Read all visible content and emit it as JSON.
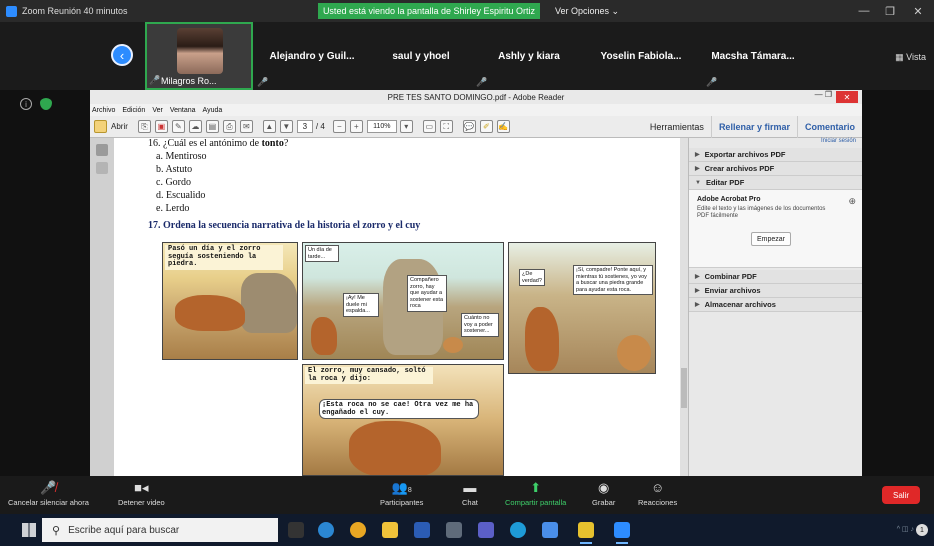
{
  "zoom": {
    "window_title": "Zoom Reunión 40 minutos",
    "share_banner": "Usted está viendo la pantalla de Shirley Espiritu Ortiz",
    "view_options": "Ver Opciones ⌄",
    "vista_label": "Vista",
    "participants": [
      {
        "name": "Milagros Ro..."
      },
      {
        "name": "Alejandro y Guil..."
      },
      {
        "name": "saul y yhoel"
      },
      {
        "name": "Ashly y kiara"
      },
      {
        "name": "Yoselin Fabiola..."
      },
      {
        "name": "Macsha Támara..."
      }
    ]
  },
  "adobe": {
    "title": "PRE TES SANTO DOMINGO.pdf - Adobe Reader",
    "menu": [
      "Archivo",
      "Edición",
      "Ver",
      "Ventana",
      "Ayuda"
    ],
    "toolbar": {
      "open_label": "Abrir",
      "page_current": "3",
      "page_total": "/ 4",
      "zoom": "110%",
      "tools": "Herramientas",
      "fill_sign": "Rellenar y firmar",
      "comment": "Comentario"
    },
    "right_pane": {
      "login": "Iniciar sesión",
      "sections": [
        "Exportar archivos PDF",
        "Crear archivos PDF",
        "Editar PDF"
      ],
      "edit_title": "Adobe Acrobat Pro",
      "edit_desc": "Edite el texto y las imágenes de los documentos PDF fácilmente",
      "start_button": "Empezar",
      "sections_bottom": [
        "Combinar PDF",
        "Enviar archivos",
        "Almacenar archivos"
      ]
    }
  },
  "document": {
    "q16_prefix": "16. ¿Cuál es el antónimo de ",
    "q16_word": "tonto",
    "q16_suffix": "?",
    "options": [
      "a.   Mentiroso",
      "b.   Astuto",
      "c.   Gordo",
      "d.   Escualido",
      "e.   Lerdo"
    ],
    "q17": "17. Ordena la secuencia narrativa de la historia el zorro y el cuy",
    "panel1_caption": "Pasó un día y el zorro seguía sosteniendo la piedra.",
    "panel2_caption_a": "Un día de tarde...",
    "panel2_caption_b": "¡Ay! Me duele mi espalda...",
    "panel2_caption_c": "Compañero zorro, hay que ayudar a sostener esta roca",
    "panel2_caption_d": "Cuánto no voy a poder sostener...",
    "panel3_caption_a": "¿De verdad?",
    "panel3_caption_b": "¡Sí, compadre! Ponte aquí, y mientras tú sostienes, yo voy a buscar una piedra grande para ayudar esta roca.",
    "panel4_caption_a": "El zorro, muy cansado, soltó la roca y dijo:",
    "panel4_caption_b": "¡Esta roca no se cae! Otra vez me ha engañado el cuy."
  },
  "bottom_bar": {
    "mute": "Cancelar silenciar ahora",
    "video": "Detener video",
    "participants": "Participantes",
    "participants_count": "8",
    "chat": "Chat",
    "share": "Compartir pantalla",
    "record": "Grabar",
    "reactions": "Reacciones",
    "leave": "Salir"
  },
  "taskbar": {
    "search_placeholder": "Escribe aquí para buscar",
    "notification_count": "1"
  },
  "colors": {
    "zoom_blue": "#2d8cff",
    "share_green": "#2fa84f",
    "leave_red": "#e02828",
    "adobe_link": "#2f5fa8"
  }
}
